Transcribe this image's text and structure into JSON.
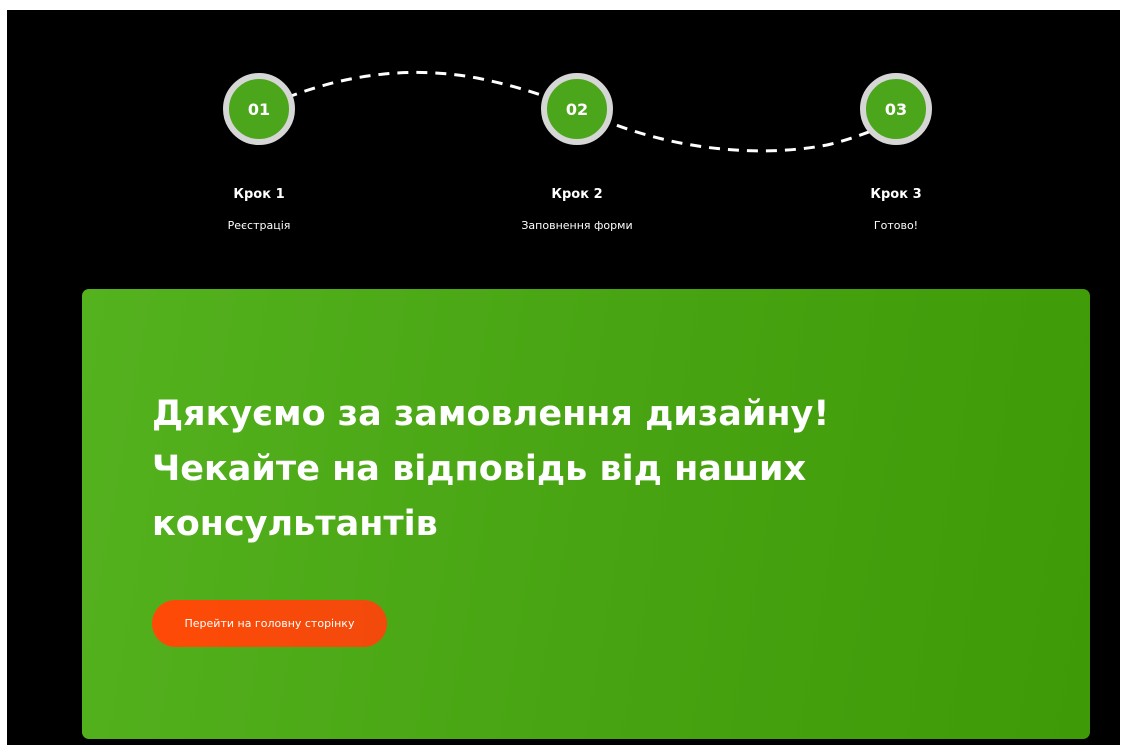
{
  "steps": [
    {
      "number": "01",
      "title": "Крок 1",
      "subtitle": "Реєстрація"
    },
    {
      "number": "02",
      "title": "Крок 2",
      "subtitle": "Заповнення форми"
    },
    {
      "number": "03",
      "title": "Крок 3",
      "subtitle": "Готово!"
    }
  ],
  "thankyou": {
    "headline_lines": [
      "Дякуємо за замовлення дизайну!",
      "Чекайте на відповідь від наших",
      "консультантів"
    ],
    "cta_label": "Перейти на головну сторінку"
  },
  "colors": {
    "page_background": "#000000",
    "accent_green": "#4ca61b",
    "circle_ring": "#d6d6d6",
    "cta_orange": "#ff4a06",
    "text": "#ffffff"
  }
}
